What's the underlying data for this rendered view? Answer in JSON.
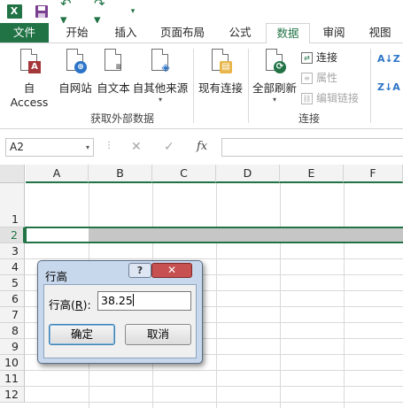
{
  "qat": {
    "logo_text": "X",
    "undo_glyph": "↶ ▾",
    "redo_glyph": "↷ ▾",
    "customize_glyph": "▾"
  },
  "tabs": [
    "文件",
    "开始",
    "插入",
    "页面布局",
    "公式",
    "数据",
    "审阅",
    "视图"
  ],
  "active_tab": "数据",
  "ribbon": {
    "external_group": {
      "label": "获取外部数据",
      "buttons": [
        {
          "label": "自 Access",
          "icon": "access-database-icon",
          "badge": "A"
        },
        {
          "label": "自网站",
          "icon": "globe-web-icon",
          "badge": "⊕"
        },
        {
          "label": "自文本",
          "icon": "text-file-icon",
          "badge": "≡"
        },
        {
          "label": "自其他来源",
          "icon": "other-sources-icon",
          "badge": "◈",
          "dropdown": "▾"
        }
      ]
    },
    "existing_connections": {
      "label": "现有连接",
      "icon": "database-icon",
      "badge": "▤"
    },
    "connections_group": {
      "label": "连接",
      "refresh_all": {
        "label": "全部刷新",
        "icon": "refresh-icon",
        "badge": "⟳",
        "dropdown": "▾"
      },
      "items": [
        {
          "label": "连接",
          "icon": "connections-icon",
          "glyph": "⇄",
          "enabled": true
        },
        {
          "label": "属性",
          "icon": "properties-icon",
          "glyph": "≡",
          "enabled": false
        },
        {
          "label": "编辑链接",
          "icon": "edit-links-icon",
          "glyph": "⛓",
          "enabled": false
        }
      ]
    },
    "sort": {
      "asc_glyph": "A↓Z",
      "desc_glyph": "Z↓A"
    }
  },
  "formula_bar": {
    "name_box": "A2",
    "dropdown": "▾",
    "dots": "⋮",
    "cancel": "✕",
    "enter": "✓",
    "fx": "fx",
    "formula": ""
  },
  "grid": {
    "columns": [
      "A",
      "B",
      "C",
      "D",
      "E",
      "F"
    ],
    "rows": [
      "1",
      "2",
      "3",
      "4",
      "5",
      "6",
      "7",
      "8",
      "9",
      "10",
      "11",
      "12"
    ],
    "active_row": "2"
  },
  "dialog": {
    "title": "行高",
    "help": "?",
    "close": "✕",
    "field_label_pre": "行高(",
    "field_label_key": "R",
    "field_label_post": "):",
    "field_value": "38.25",
    "ok_label": "确定",
    "cancel_label": "取消"
  },
  "colors": {
    "excel_green": "#217346",
    "dialog_frame": "#c8d8ec",
    "close_red": "#c75050",
    "selection_gray": "#c6c6c6"
  }
}
